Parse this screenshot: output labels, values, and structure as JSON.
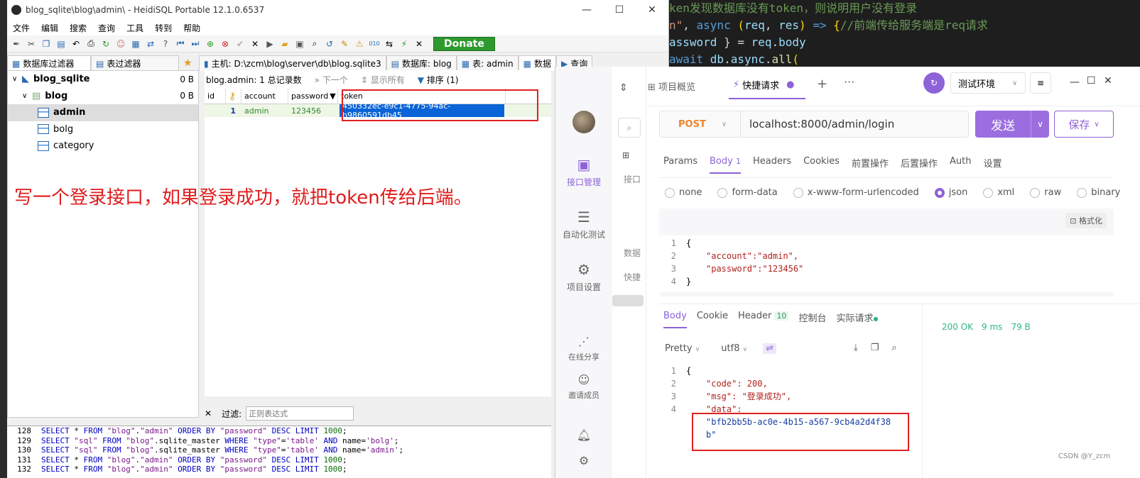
{
  "editor": {
    "lines": [
      {
        "parts": [
          {
            "t": "ken发现数据库没有token，则说明用户没有登录",
            "c": "cm"
          }
        ]
      },
      {
        "parts": [
          {
            "t": "n\"",
            "c": "str"
          },
          {
            "t": ", ",
            "c": "p"
          },
          {
            "t": "async",
            "c": "kw"
          },
          {
            "t": " (",
            "c": "br"
          },
          {
            "t": "req",
            "c": "var"
          },
          {
            "t": ", ",
            "c": "p"
          },
          {
            "t": "res",
            "c": "var"
          },
          {
            "t": ") ",
            "c": "br"
          },
          {
            "t": "=> ",
            "c": "kw"
          },
          {
            "t": "{",
            "c": "br"
          },
          {
            "t": "//前端传给服务端是req请求",
            "c": "cm"
          }
        ]
      },
      {
        "parts": [
          {
            "t": "assword",
            "c": "var"
          },
          {
            "t": " } = ",
            "c": "p"
          },
          {
            "t": "req",
            "c": "var"
          },
          {
            "t": ".",
            "c": "p"
          },
          {
            "t": "body",
            "c": "var"
          }
        ]
      },
      {
        "parts": [
          {
            "t": "await ",
            "c": "kw"
          },
          {
            "t": "db",
            "c": "var"
          },
          {
            "t": ".",
            "c": "p"
          },
          {
            "t": "async",
            "c": "var"
          },
          {
            "t": ".",
            "c": "p"
          },
          {
            "t": "all",
            "c": "fn"
          },
          {
            "t": "(",
            "c": "br"
          }
        ]
      }
    ]
  },
  "heidi": {
    "title": "blog_sqlite\\blog\\admin\\ - HeidiSQL Portable 12.1.0.6537",
    "menu": [
      "文件",
      "编辑",
      "搜索",
      "查询",
      "工具",
      "转到",
      "帮助"
    ],
    "donate": "Donate",
    "filter_tabs": [
      "数据库过滤器",
      "表过滤器"
    ],
    "tabs": [
      "主机: D:\\zcm\\blog\\server\\db\\blog.sqlite3",
      "数据库: blog",
      "表: admin",
      "数据",
      "查询"
    ],
    "tree": [
      {
        "label": "blog_sqlite",
        "size": "0 B",
        "level": 0,
        "bold": true
      },
      {
        "label": "blog",
        "size": "0 B",
        "level": 1,
        "bold": true
      },
      {
        "label": "admin",
        "size": "",
        "level": 2,
        "bold": true,
        "selected": true
      },
      {
        "label": "bolg",
        "size": "",
        "level": 2
      },
      {
        "label": "category",
        "size": "",
        "level": 2
      }
    ],
    "grid_info": "blog.admin: 1 总记录数",
    "grid_next": "下一个",
    "grid_showall": "显示所有",
    "grid_sort": "排序 (1)",
    "columns": [
      "id",
      "account",
      "password",
      "token"
    ],
    "rows": [
      [
        "1",
        "admin",
        "123456",
        "450332ec-e9c1-4775-94ac-b9860591db45"
      ]
    ],
    "filter_label": "过滤:",
    "filter_placeholder": "正则表达式",
    "sql_log": [
      {
        "n": "128",
        "parts": [
          [
            "kw",
            "SELECT"
          ],
          [
            "p",
            " * "
          ],
          [
            "kw",
            "FROM"
          ],
          [
            "p",
            " "
          ],
          [
            "str",
            "\"blog\""
          ],
          [
            "p",
            "."
          ],
          [
            "str",
            "\"admin\""
          ],
          [
            "p",
            " "
          ],
          [
            "kw",
            "ORDER BY"
          ],
          [
            "p",
            " "
          ],
          [
            "str",
            "\"password\""
          ],
          [
            "p",
            " "
          ],
          [
            "kw",
            "DESC LIMIT"
          ],
          [
            "p",
            " "
          ],
          [
            "num",
            "1000"
          ],
          [
            "p",
            ";"
          ]
        ]
      },
      {
        "n": "129",
        "parts": [
          [
            "kw",
            "SELECT"
          ],
          [
            "p",
            " "
          ],
          [
            "str",
            "\"sql\""
          ],
          [
            "p",
            " "
          ],
          [
            "kw",
            "FROM"
          ],
          [
            "p",
            " "
          ],
          [
            "str",
            "\"blog\""
          ],
          [
            "p",
            "."
          ],
          [
            "p",
            "sqlite_master "
          ],
          [
            "kw",
            "WHERE"
          ],
          [
            "p",
            " "
          ],
          [
            "str",
            "\"type\""
          ],
          [
            "p",
            "="
          ],
          [
            "str",
            "'table'"
          ],
          [
            "p",
            " "
          ],
          [
            "kw",
            "AND"
          ],
          [
            "p",
            " name="
          ],
          [
            "str",
            "'bolg'"
          ],
          [
            "p",
            ";"
          ]
        ]
      },
      {
        "n": "130",
        "parts": [
          [
            "kw",
            "SELECT"
          ],
          [
            "p",
            " "
          ],
          [
            "str",
            "\"sql\""
          ],
          [
            "p",
            " "
          ],
          [
            "kw",
            "FROM"
          ],
          [
            "p",
            " "
          ],
          [
            "str",
            "\"blog\""
          ],
          [
            "p",
            "."
          ],
          [
            "p",
            "sqlite_master "
          ],
          [
            "kw",
            "WHERE"
          ],
          [
            "p",
            " "
          ],
          [
            "str",
            "\"type\""
          ],
          [
            "p",
            "="
          ],
          [
            "str",
            "'table'"
          ],
          [
            "p",
            " "
          ],
          [
            "kw",
            "AND"
          ],
          [
            "p",
            " name="
          ],
          [
            "str",
            "'admin'"
          ],
          [
            "p",
            ";"
          ]
        ]
      },
      {
        "n": "131",
        "parts": [
          [
            "kw",
            "SELECT"
          ],
          [
            "p",
            " * "
          ],
          [
            "kw",
            "FROM"
          ],
          [
            "p",
            " "
          ],
          [
            "str",
            "\"blog\""
          ],
          [
            "p",
            "."
          ],
          [
            "str",
            "\"admin\""
          ],
          [
            "p",
            " "
          ],
          [
            "kw",
            "ORDER BY"
          ],
          [
            "p",
            " "
          ],
          [
            "str",
            "\"password\""
          ],
          [
            "p",
            " "
          ],
          [
            "kw",
            "DESC LIMIT"
          ],
          [
            "p",
            " "
          ],
          [
            "num",
            "1000"
          ],
          [
            "p",
            ";"
          ]
        ]
      },
      {
        "n": "132",
        "parts": [
          [
            "kw",
            "SELECT"
          ],
          [
            "p",
            " * "
          ],
          [
            "kw",
            "FROM"
          ],
          [
            "p",
            " "
          ],
          [
            "str",
            "\"blog\""
          ],
          [
            "p",
            "."
          ],
          [
            "str",
            "\"admin\""
          ],
          [
            "p",
            " "
          ],
          [
            "kw",
            "ORDER BY"
          ],
          [
            "p",
            " "
          ],
          [
            "str",
            "\"password\""
          ],
          [
            "p",
            " "
          ],
          [
            "kw",
            "DESC LIMIT"
          ],
          [
            "p",
            " "
          ],
          [
            "num",
            "1000"
          ],
          [
            "p",
            ";"
          ]
        ]
      }
    ]
  },
  "annotation": "写一个登录接口，如果登录成功，就把token传给后端。",
  "apifox": {
    "sidebar": [
      "接口管理",
      "自动化测试",
      "项目设置",
      "在线分享",
      "邀请成员"
    ],
    "side2": [
      "接口",
      "数据",
      "快捷"
    ],
    "tabs": [
      "项目概览",
      "快捷请求"
    ],
    "env": "测试环境",
    "method": "POST",
    "url": "localhost:8000/admin/login",
    "send": "发送",
    "save": "保存",
    "req_tabs": [
      "Params",
      "Body",
      "Headers",
      "Cookies",
      "前置操作",
      "后置操作",
      "Auth",
      "设置"
    ],
    "body_count": "1",
    "body_types": [
      "none",
      "form-data",
      "x-www-form-urlencoded",
      "json",
      "xml",
      "raw",
      "binary"
    ],
    "format_btn": "格式化",
    "req_body": [
      "{",
      "\"account\":\"admin\",",
      "\"password\":\"123456\"",
      "}"
    ],
    "resp_tabs": [
      "Body",
      "Cookie",
      "Header",
      "控制台",
      "实际请求"
    ],
    "header_count": "10",
    "resp_format": "Pretty",
    "resp_encoding": "utf8",
    "status": "200 OK",
    "time": "9 ms",
    "size": "79 B",
    "resp_lines": [
      "{",
      "\"code\": 200,",
      "\"msg\": \"登录成功\",",
      "\"data\":",
      "\"bfb2bb5b-ac0e-4b15-a567-9cb4a2d4f38",
      "b\""
    ],
    "resp_nums": [
      "1",
      "2",
      "3",
      "4",
      "",
      ""
    ],
    "watermark": "CSDN @Y_zcm"
  }
}
